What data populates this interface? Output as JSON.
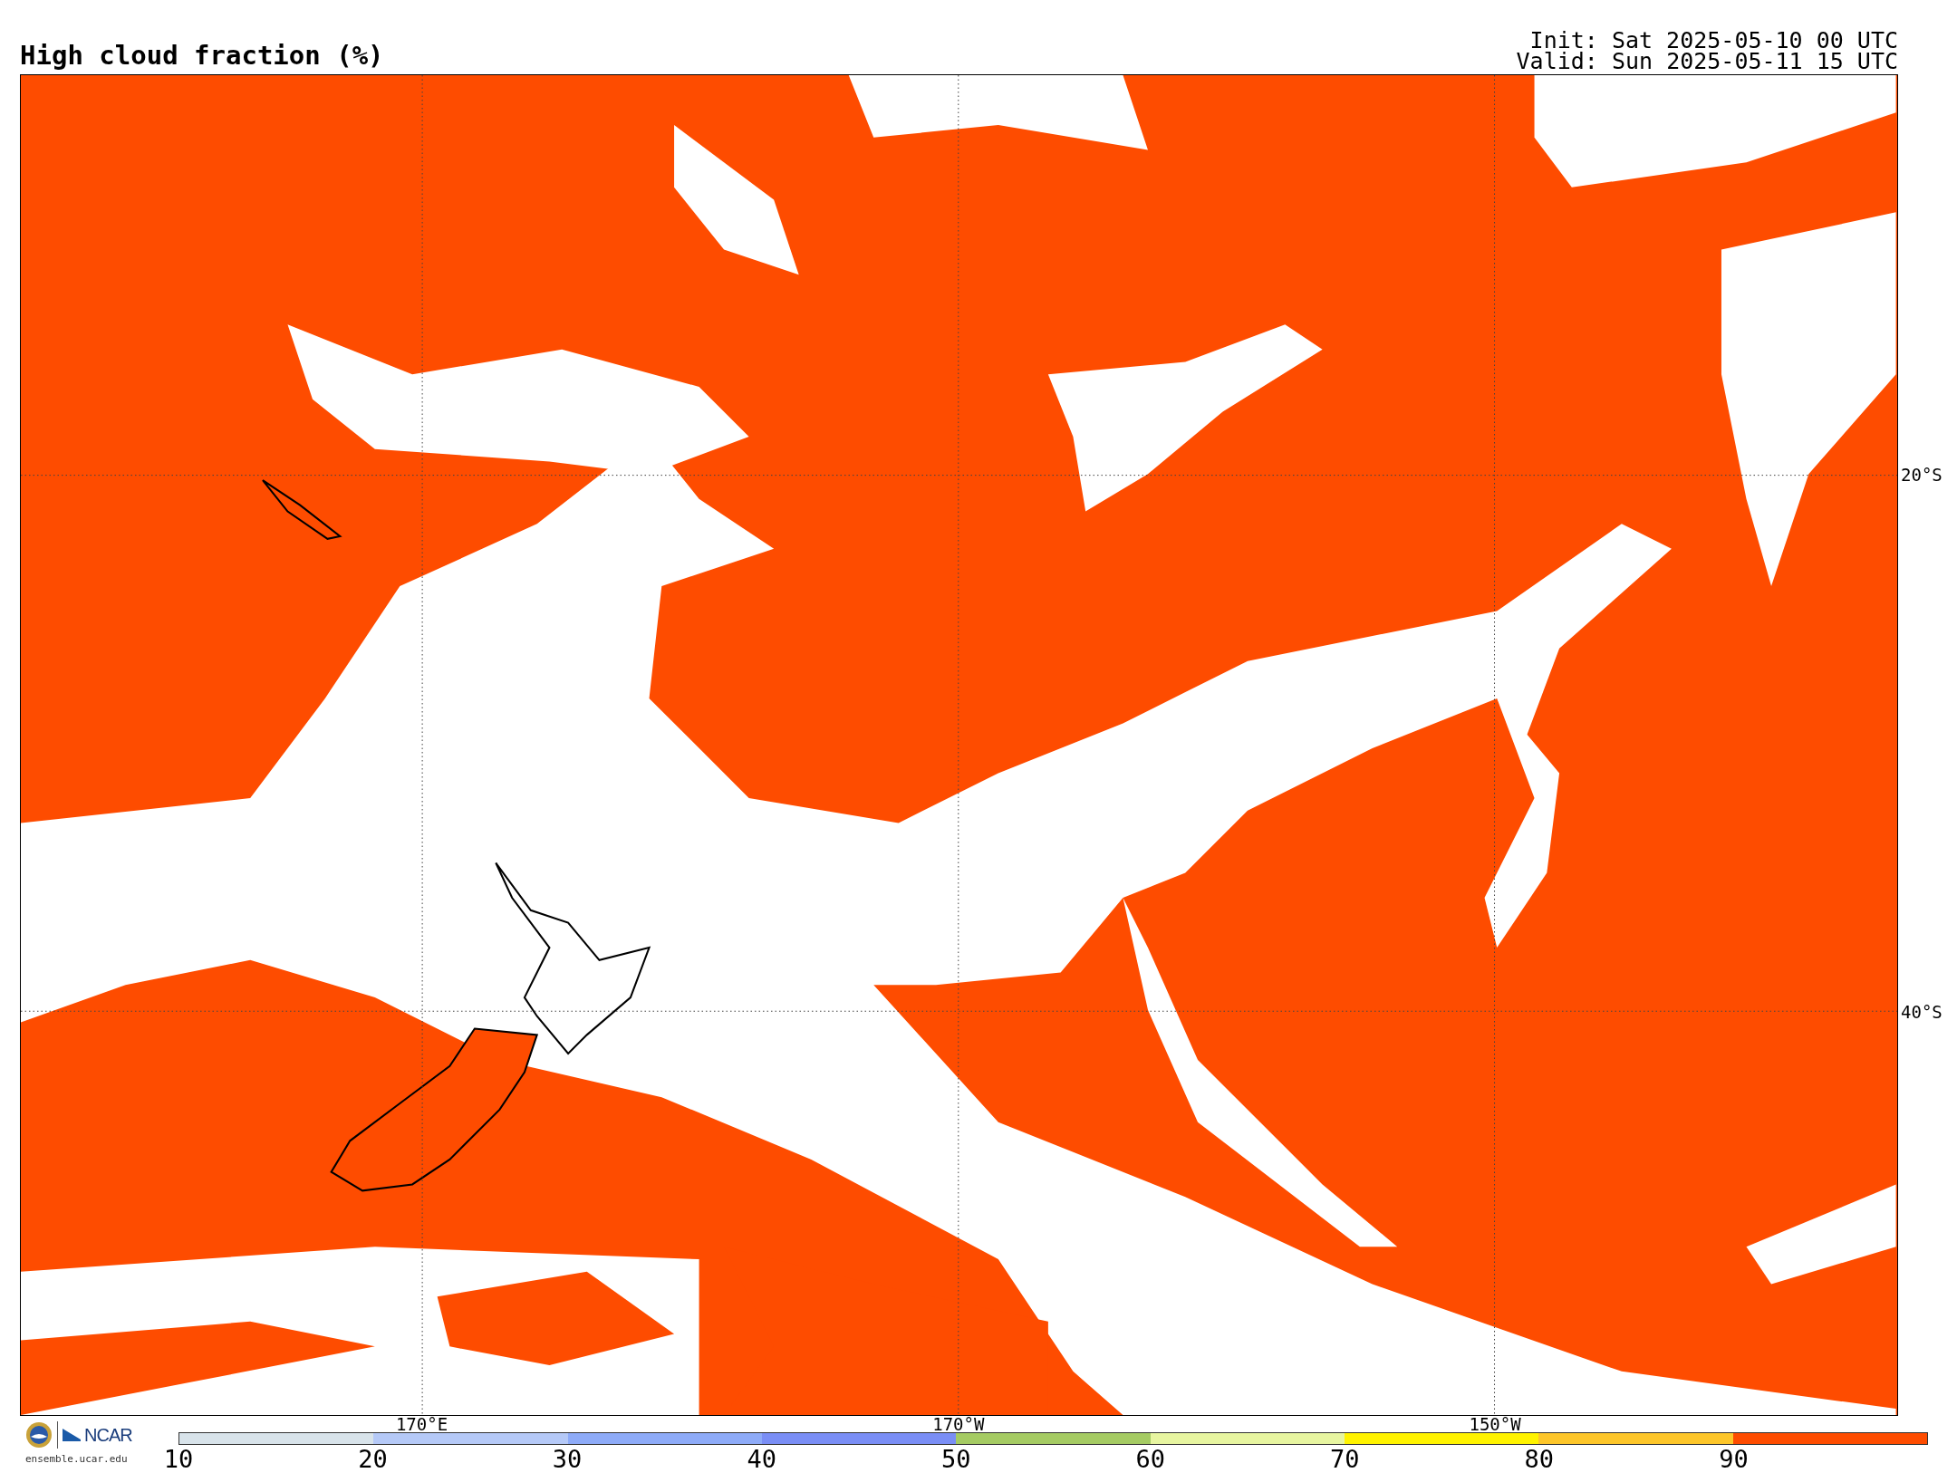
{
  "title": "High cloud fraction (%)",
  "init": "Init: Sat 2025-05-10 00 UTC",
  "valid": "Valid: Sun 2025-05-11 15 UTC",
  "map": {
    "latitude_labels": [
      "20°S",
      "40°S"
    ],
    "longitude_labels": [
      "170°E",
      "170°W",
      "150°W"
    ]
  },
  "colorbar": {
    "bins": [
      {
        "color": "#d8e3ea"
      },
      {
        "color": "#b5c9f7"
      },
      {
        "color": "#8eabf8"
      },
      {
        "color": "#7a8ef5"
      },
      {
        "color": "#a5cb63"
      },
      {
        "color": "#e7f5a0"
      },
      {
        "color": "#fff300"
      },
      {
        "color": "#fdc62a"
      },
      {
        "color": "#fe4c00"
      }
    ],
    "ticks": [
      "10",
      "20",
      "30",
      "40",
      "50",
      "60",
      "70",
      "80",
      "90"
    ]
  },
  "footer": {
    "logo_text": "NCAR",
    "site": "ensemble.ucar.edu"
  }
}
